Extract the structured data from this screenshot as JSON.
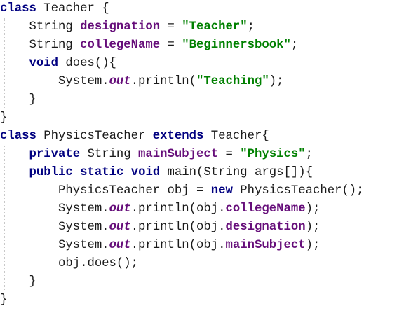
{
  "code": {
    "language": "Java",
    "colors": {
      "keyword": "#000080",
      "field": "#660e7a",
      "string": "#008000",
      "plain": "#1a1a1a",
      "background": "#ffffff"
    },
    "lines": [
      [
        {
          "t": "kw",
          "v": "class"
        },
        {
          "t": "plain",
          "v": " Teacher {"
        }
      ],
      [
        {
          "t": "plain",
          "v": "    String "
        },
        {
          "t": "fld",
          "v": "designation"
        },
        {
          "t": "plain",
          "v": " = "
        },
        {
          "t": "str",
          "v": "\"Teacher\""
        },
        {
          "t": "plain",
          "v": ";"
        }
      ],
      [
        {
          "t": "plain",
          "v": "    String "
        },
        {
          "t": "fld",
          "v": "collegeName"
        },
        {
          "t": "plain",
          "v": " = "
        },
        {
          "t": "str",
          "v": "\"Beginnersbook\""
        },
        {
          "t": "plain",
          "v": ";"
        }
      ],
      [
        {
          "t": "plain",
          "v": "    "
        },
        {
          "t": "kw",
          "v": "void"
        },
        {
          "t": "plain",
          "v": " does(){"
        }
      ],
      [
        {
          "t": "plain",
          "v": "        System."
        },
        {
          "t": "sfld",
          "v": "out"
        },
        {
          "t": "plain",
          "v": ".println("
        },
        {
          "t": "str",
          "v": "\"Teaching\""
        },
        {
          "t": "plain",
          "v": ");"
        }
      ],
      [
        {
          "t": "plain",
          "v": "    }"
        }
      ],
      [
        {
          "t": "plain",
          "v": "}"
        }
      ],
      [
        {
          "t": "kw",
          "v": "class"
        },
        {
          "t": "plain",
          "v": " PhysicsTeacher "
        },
        {
          "t": "kw",
          "v": "extends"
        },
        {
          "t": "plain",
          "v": " Teacher{"
        }
      ],
      [
        {
          "t": "plain",
          "v": "    "
        },
        {
          "t": "kw",
          "v": "private"
        },
        {
          "t": "plain",
          "v": " String "
        },
        {
          "t": "fld",
          "v": "mainSubject"
        },
        {
          "t": "plain",
          "v": " = "
        },
        {
          "t": "str",
          "v": "\"Physics\""
        },
        {
          "t": "plain",
          "v": ";"
        }
      ],
      [
        {
          "t": "plain",
          "v": "    "
        },
        {
          "t": "kw",
          "v": "public"
        },
        {
          "t": "plain",
          "v": " "
        },
        {
          "t": "kw",
          "v": "static"
        },
        {
          "t": "plain",
          "v": " "
        },
        {
          "t": "kw",
          "v": "void"
        },
        {
          "t": "plain",
          "v": " main(String args[]){"
        }
      ],
      [
        {
          "t": "plain",
          "v": "        PhysicsTeacher obj = "
        },
        {
          "t": "kw",
          "v": "new"
        },
        {
          "t": "plain",
          "v": " PhysicsTeacher();"
        }
      ],
      [
        {
          "t": "plain",
          "v": "        System."
        },
        {
          "t": "sfld",
          "v": "out"
        },
        {
          "t": "plain",
          "v": ".println(obj."
        },
        {
          "t": "fld",
          "v": "collegeName"
        },
        {
          "t": "plain",
          "v": ");"
        }
      ],
      [
        {
          "t": "plain",
          "v": "        System."
        },
        {
          "t": "sfld",
          "v": "out"
        },
        {
          "t": "plain",
          "v": ".println(obj."
        },
        {
          "t": "fld",
          "v": "designation"
        },
        {
          "t": "plain",
          "v": ");"
        }
      ],
      [
        {
          "t": "plain",
          "v": "        System."
        },
        {
          "t": "sfld",
          "v": "out"
        },
        {
          "t": "plain",
          "v": ".println(obj."
        },
        {
          "t": "fld",
          "v": "mainSubject"
        },
        {
          "t": "plain",
          "v": ");"
        }
      ],
      [
        {
          "t": "plain",
          "v": "        obj.does();"
        }
      ],
      [
        {
          "t": "plain",
          "v": "    }"
        }
      ],
      [
        {
          "t": "plain",
          "v": "}"
        }
      ]
    ]
  }
}
